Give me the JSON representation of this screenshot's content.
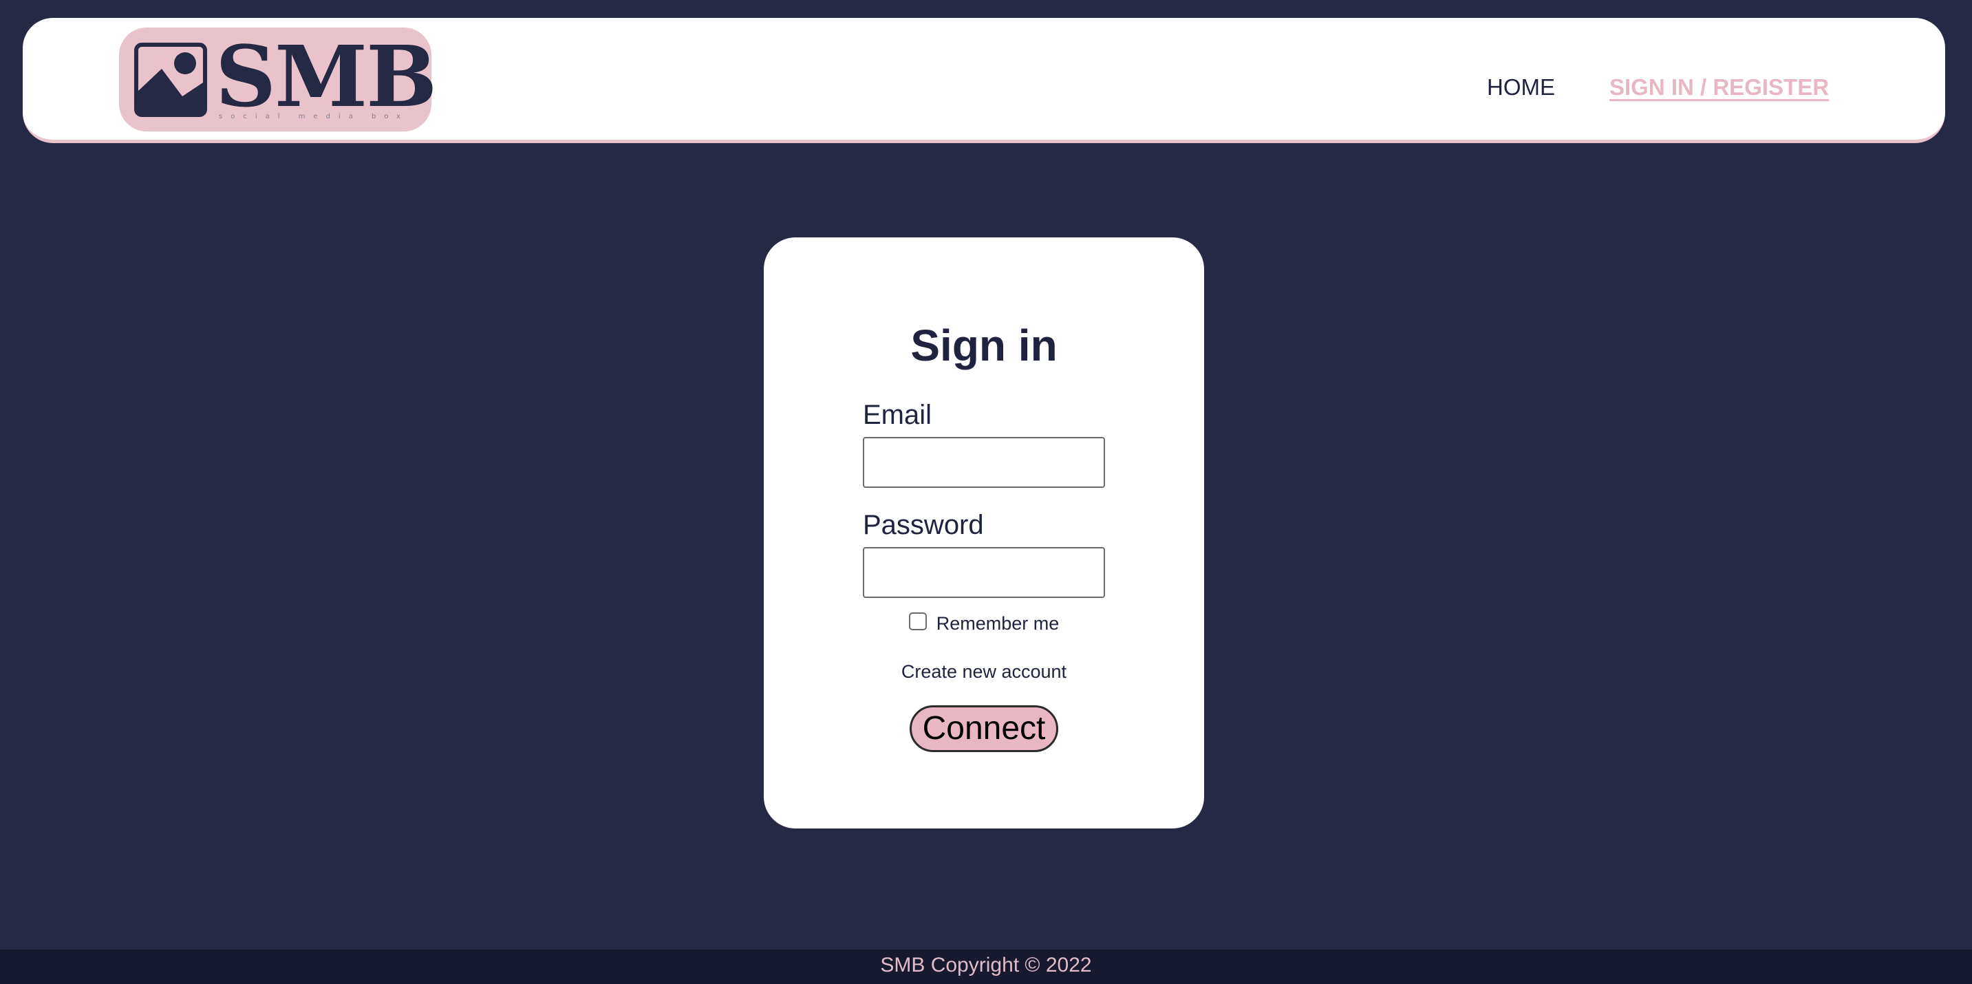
{
  "header": {
    "logo": {
      "text": "SMB",
      "tagline": "social media box",
      "icon": "image-icon"
    },
    "nav": {
      "home_label": "HOME",
      "signin_label": "SIGN IN / REGISTER"
    }
  },
  "signin_card": {
    "title": "Sign in",
    "email_label": "Email",
    "email_value": "",
    "password_label": "Password",
    "password_value": "",
    "remember_label": "Remember me",
    "remember_checked": false,
    "create_account_label": "Create new account",
    "connect_label": "Connect"
  },
  "footer": {
    "copyright": "SMB Copyright © 2022"
  },
  "colors": {
    "background": "#252944",
    "accent_pink": "#e9b7c4",
    "navy_text": "#1f2340",
    "footer_bg": "#171a2e"
  }
}
